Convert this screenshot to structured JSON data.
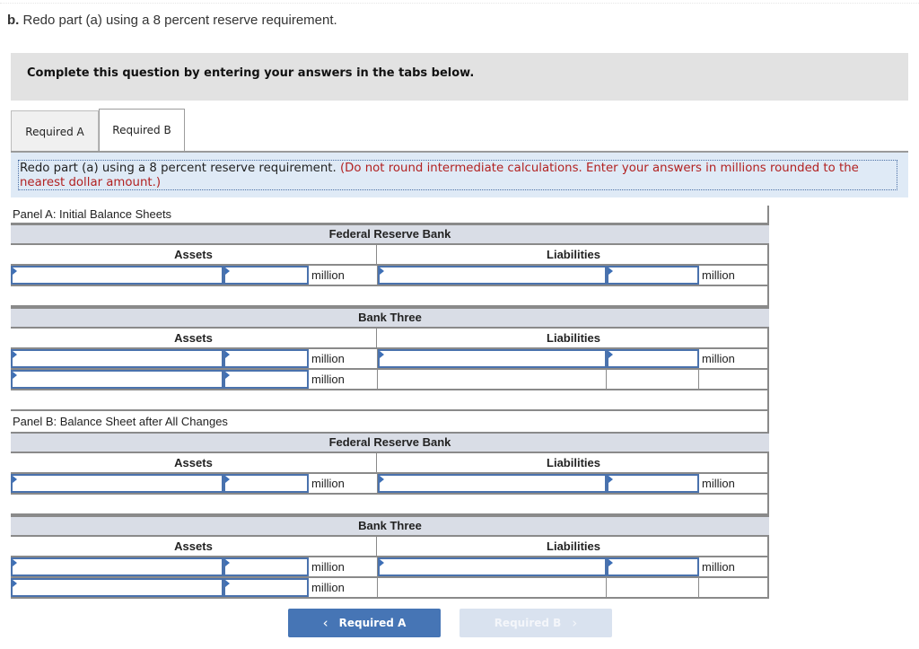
{
  "question": {
    "prefix": "b.",
    "text": " Redo part (a) using a 8 percent reserve requirement."
  },
  "banner": "Complete this question by entering your answers in the tabs below.",
  "tabs": [
    {
      "label": "Required A",
      "active": false
    },
    {
      "label": "Required B",
      "active": true
    }
  ],
  "instructions": {
    "main": "Redo part (a) using a 8 percent reserve requirement. ",
    "note": "(Do not round intermediate calculations. Enter your answers in millions rounded to the nearest dollar amount.)"
  },
  "panels": [
    {
      "label": "Panel A: Initial Balance Sheets",
      "banks": [
        {
          "name": "Federal Reserve Bank",
          "assets_header": "Assets",
          "liabilities_header": "Liabilities",
          "rows": [
            {
              "asset_name": "",
              "asset_value": "",
              "asset_unit": "million",
              "liab_name": "",
              "liab_value": "",
              "liab_unit": "million"
            }
          ]
        },
        {
          "name": "Bank Three",
          "assets_header": "Assets",
          "liabilities_header": "Liabilities",
          "rows": [
            {
              "asset_name": "",
              "asset_value": "",
              "asset_unit": "million",
              "liab_name": "",
              "liab_value": "",
              "liab_unit": "million"
            },
            {
              "asset_name": "",
              "asset_value": "",
              "asset_unit": "million"
            }
          ]
        }
      ]
    },
    {
      "label": "Panel B: Balance Sheet after All Changes",
      "banks": [
        {
          "name": "Federal Reserve Bank",
          "assets_header": "Assets",
          "liabilities_header": "Liabilities",
          "rows": [
            {
              "asset_name": "",
              "asset_value": "",
              "asset_unit": "million",
              "liab_name": "",
              "liab_value": "",
              "liab_unit": "million"
            }
          ]
        },
        {
          "name": "Bank Three",
          "assets_header": "Assets",
          "liabilities_header": "Liabilities",
          "rows": [
            {
              "asset_name": "",
              "asset_value": "",
              "asset_unit": "million",
              "liab_name": "",
              "liab_value": "",
              "liab_unit": "million"
            },
            {
              "asset_name": "",
              "asset_value": "",
              "asset_unit": "million"
            }
          ]
        }
      ]
    }
  ],
  "navigation": {
    "prev_label": "Required A",
    "prev_icon": "chevron-left-icon",
    "next_label": "Required B",
    "next_icon": "chevron-right-icon",
    "next_disabled": true
  },
  "colors": {
    "primary_button": "#4675b5",
    "disabled_button": "#d9e2ef",
    "instruction_note": "#b22222",
    "band_bg": "#d9dde6",
    "input_border": "#4a72ad"
  }
}
